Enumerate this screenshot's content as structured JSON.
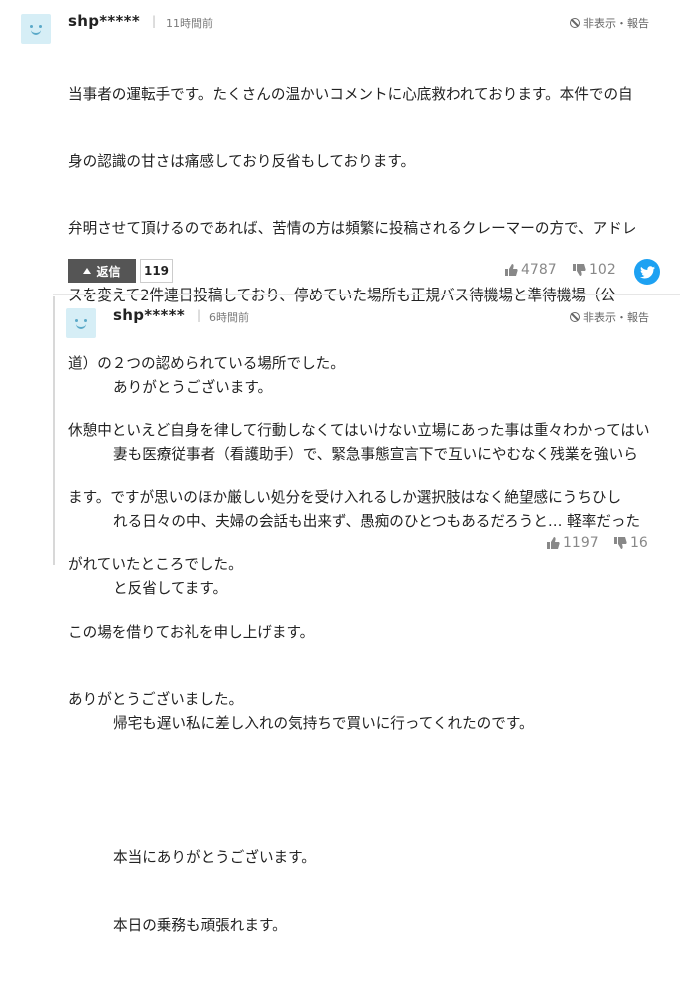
{
  "comment": {
    "username": "shp*****",
    "time": "11時間前",
    "hide_report": "非表示・報告",
    "lines": [
      "当事者の運転手です。たくさんの温かいコメントに心底救われております。本件での自",
      "身の認識の甘さは痛感しており反省もしております。",
      "弁明させて頂けるのであれば、苦情の方は頻繁に投稿されるクレーマーの方で、アドレ",
      "スを変えて2件連日投稿しており、停めていた場所も正規バス待機場と準待機場（公",
      "道）の２つの認められている場所でした。",
      "休憩中といえど自身を律して行動しなくてはいけない立場にあった事は重々わかってはい",
      "ます。ですが思いのほか厳しい処分を受け入れるしか選択肢はなく絶望感にうちひし",
      "がれていたところでした。",
      "この場を借りてお礼を申し上げます。",
      "ありがとうございました。"
    ],
    "reply_label": "返信",
    "reply_count": "119",
    "likes": "4787",
    "dislikes": "102"
  },
  "reply": {
    "username": "shp*****",
    "time": "6時間前",
    "hide_report": "非表示・報告",
    "lines": [
      "ありがとうございます。",
      "妻も医療従事者（看護助手）で、緊急事態宣言下で互いにやむなく残業を強いら",
      "れる日々の中、夫婦の会話も出来ず、愚痴のひとつもあるだろうと… 軽率だった",
      "と反省してます。",
      "",
      "帰宅も遅い私に差し入れの気持ちで買いに行ってくれたのです。",
      "",
      "本当にありがとうございます。",
      "本日の乗務も頑張れます。"
    ],
    "likes": "1197",
    "dislikes": "16"
  },
  "separator": "|",
  "colors": {
    "accent_twitter": "#1da1f2",
    "reply_button": "#555555",
    "avatar_bg": "#d6eef6"
  },
  "icons": [
    "avatar-icon",
    "ban-icon",
    "thumbs-up-icon",
    "thumbs-down-icon",
    "twitter-icon",
    "reply-arrow-icon"
  ]
}
